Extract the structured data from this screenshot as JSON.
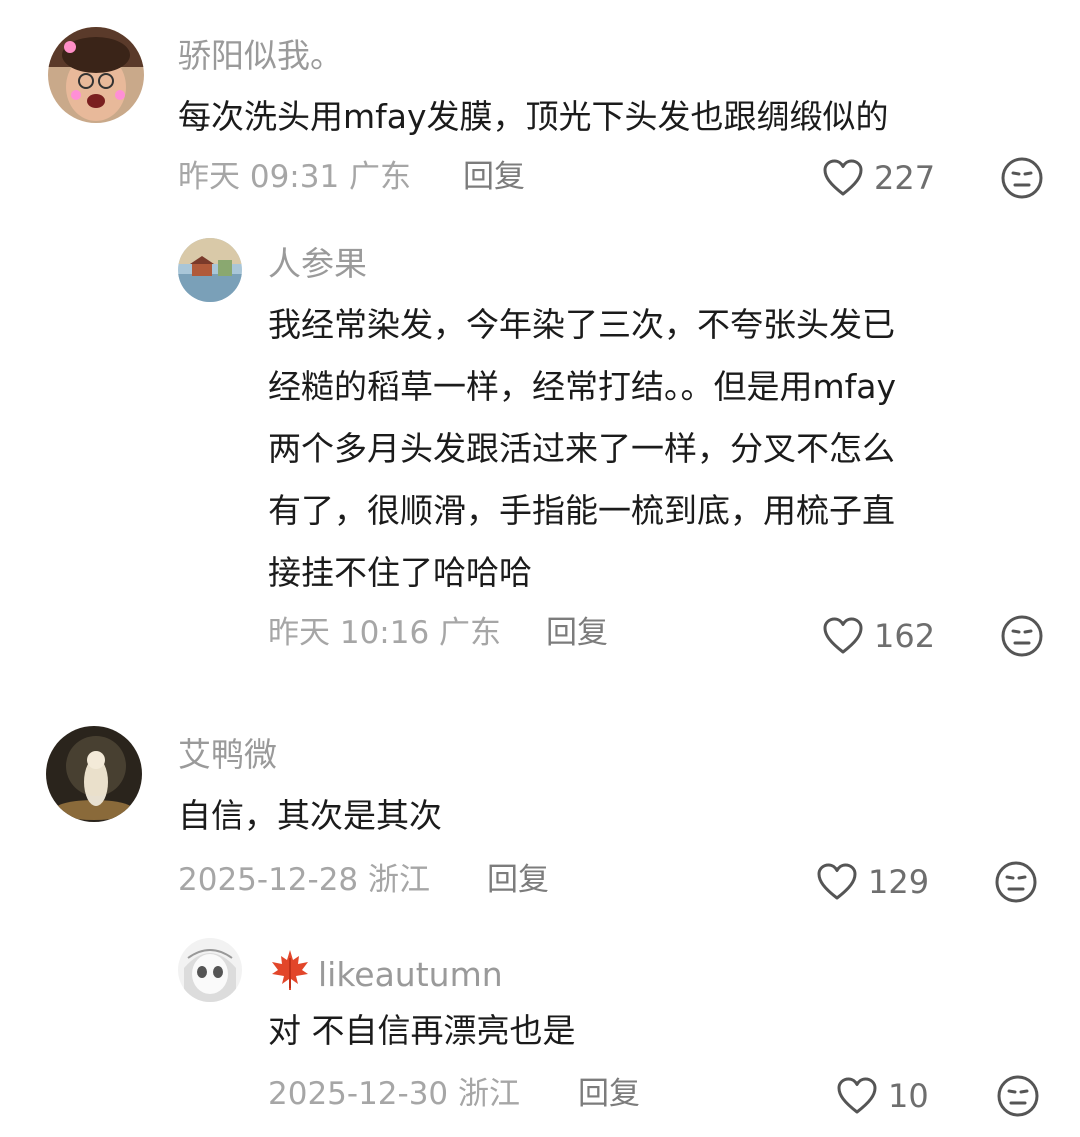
{
  "comments": [
    {
      "user": "骄阳似我。",
      "text": "每次洗头用mfay发膜，顶光下头发也跟绸缎似的",
      "meta": "昨天 09:31 广东",
      "reply_label": "回复",
      "likes": "227",
      "replies": [
        {
          "user": "人参果",
          "text": "我经常染发，今年染了三次，不夸张头发已\n经糙的稻草一样，经常打结。。但是用mfay\n两个多月头发跟活过来了一样，分叉不怎么\n有了，很顺滑，手指能一梳到底，用梳子直\n接挂不住了哈哈哈",
          "meta": "昨天 10:16 广东",
          "reply_label": "回复",
          "likes": "162"
        }
      ]
    },
    {
      "user": "艾鸭微",
      "text": "自信，其次是其次",
      "meta": "2025-12-28 浙江",
      "reply_label": "回复",
      "likes": "129",
      "replies": [
        {
          "user": "likeautumn",
          "text": "对 不自信再漂亮也是",
          "meta": "2025-12-30 浙江",
          "reply_label": "回复",
          "likes": "10"
        }
      ]
    }
  ],
  "icons": {
    "like": "heart-outline-icon",
    "dislike": "meh-face-icon",
    "maple": "maple-leaf-icon"
  },
  "colors": {
    "name": "#9a9a9a",
    "text": "#1b1b1b",
    "meta": "#a6a6a6",
    "icon": "#555555"
  }
}
